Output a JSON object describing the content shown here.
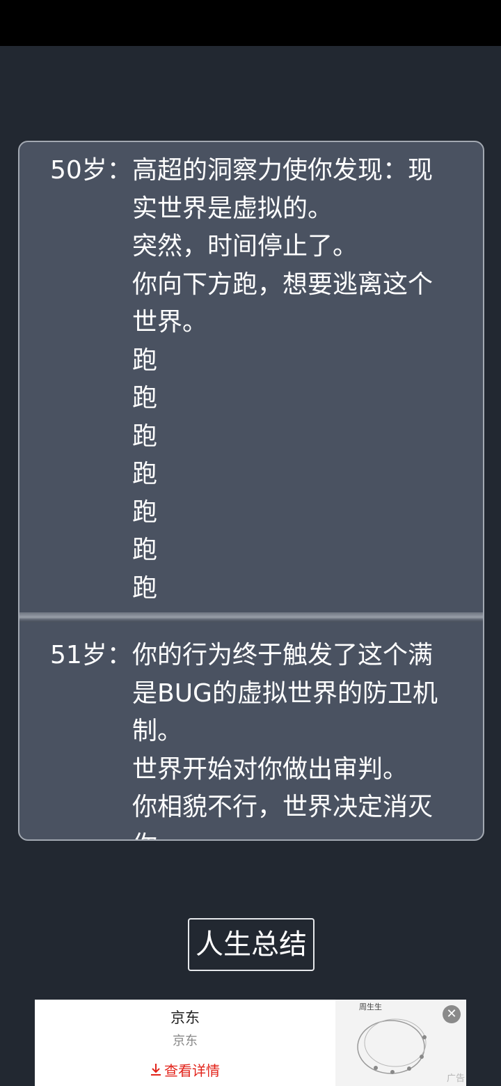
{
  "log": {
    "entries": [
      {
        "age": "50岁：",
        "lines": [
          "高超的洞察力使你发现：现",
          "实世界是虚拟的。",
          "突然，时间停止了。",
          "你向下方跑，想要逃离这个",
          "世界。",
          "跑",
          "跑",
          "跑",
          "跑",
          "跑",
          "跑",
          "跑"
        ]
      },
      {
        "age": "51岁：",
        "lines": [
          "你的行为终于触发了这个满",
          "是BUG的虚拟世界的防卫机",
          "制。",
          "世界开始对你做出审判。",
          "你相貌不行，世界决定消灭",
          "你"
        ]
      }
    ]
  },
  "summary_button": {
    "label": "人生总结"
  },
  "ad": {
    "title": "京东",
    "subtitle": "京东",
    "cta": "查看详情",
    "cta_icon": "download-arrow-icon",
    "brand": "周生生",
    "close_icon": "close-icon",
    "label": "广告",
    "cta_color": "#e2231a"
  }
}
